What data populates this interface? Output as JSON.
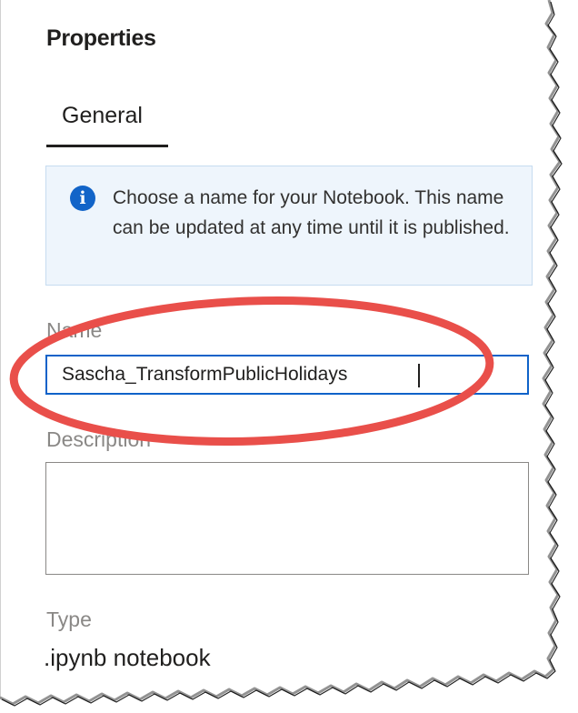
{
  "panel": {
    "title": "Properties",
    "tabs": [
      {
        "label": "General",
        "active": true
      }
    ]
  },
  "info": {
    "icon": "info-icon",
    "message": "Choose a name for your Notebook. This name can be updated at any time until it is published."
  },
  "fields": {
    "name": {
      "label": "Name",
      "value": "Sascha_TransformPublicHolidays"
    },
    "description": {
      "label": "Description",
      "value": ""
    },
    "type": {
      "label": "Type",
      "value": ".ipynb notebook"
    }
  },
  "colors": {
    "accent": "#0f62c9",
    "info_background": "#eef5fc",
    "info_icon": "#1264c8",
    "annotation": "#e94f4a"
  }
}
